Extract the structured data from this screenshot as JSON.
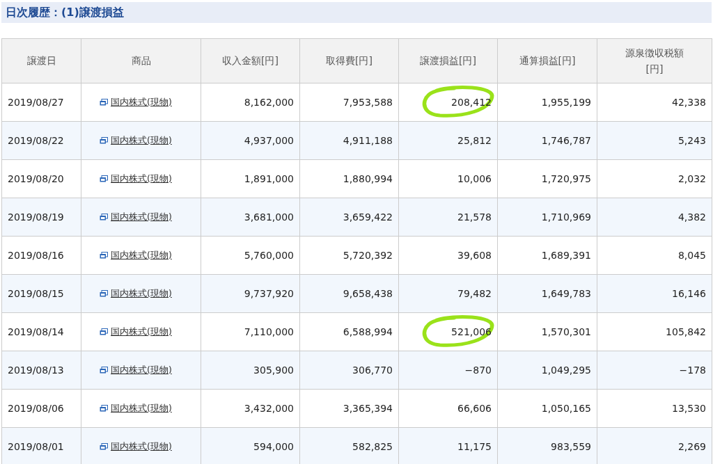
{
  "title": "日次履歴：(1)譲渡損益",
  "columns": [
    "譲渡日",
    "商品",
    "収入金額[円]",
    "取得費[円]",
    "譲渡損益[円]",
    "通算損益[円]",
    "源泉徴収税額\n[円]"
  ],
  "rows": [
    {
      "date": "2019/08/27",
      "product": "国内株式(現物)",
      "values": [
        "8,162,000",
        "7,953,588",
        "208,412",
        "1,955,199",
        "42,338"
      ],
      "circled": true
    },
    {
      "date": "2019/08/22",
      "product": "国内株式(現物)",
      "values": [
        "4,937,000",
        "4,911,188",
        "25,812",
        "1,746,787",
        "5,243"
      ],
      "circled": false
    },
    {
      "date": "2019/08/20",
      "product": "国内株式(現物)",
      "values": [
        "1,891,000",
        "1,880,994",
        "10,006",
        "1,720,975",
        "2,032"
      ],
      "circled": false
    },
    {
      "date": "2019/08/19",
      "product": "国内株式(現物)",
      "values": [
        "3,681,000",
        "3,659,422",
        "21,578",
        "1,710,969",
        "4,382"
      ],
      "circled": false
    },
    {
      "date": "2019/08/16",
      "product": "国内株式(現物)",
      "values": [
        "5,760,000",
        "5,720,392",
        "39,608",
        "1,689,391",
        "8,045"
      ],
      "circled": false
    },
    {
      "date": "2019/08/15",
      "product": "国内株式(現物)",
      "values": [
        "9,737,920",
        "9,658,438",
        "79,482",
        "1,649,783",
        "16,146"
      ],
      "circled": false
    },
    {
      "date": "2019/08/14",
      "product": "国内株式(現物)",
      "values": [
        "7,110,000",
        "6,588,994",
        "521,006",
        "1,570,301",
        "105,842"
      ],
      "circled": true
    },
    {
      "date": "2019/08/13",
      "product": "国内株式(現物)",
      "values": [
        "305,900",
        "306,770",
        "−870",
        "1,049,295",
        "−178"
      ],
      "circled": false
    },
    {
      "date": "2019/08/06",
      "product": "国内株式(現物)",
      "values": [
        "3,432,000",
        "3,365,394",
        "66,606",
        "1,050,165",
        "13,530"
      ],
      "circled": false
    },
    {
      "date": "2019/08/01",
      "product": "国内株式(現物)",
      "values": [
        "594,000",
        "582,825",
        "11,175",
        "983,559",
        "2,269"
      ],
      "circled": false
    }
  ]
}
